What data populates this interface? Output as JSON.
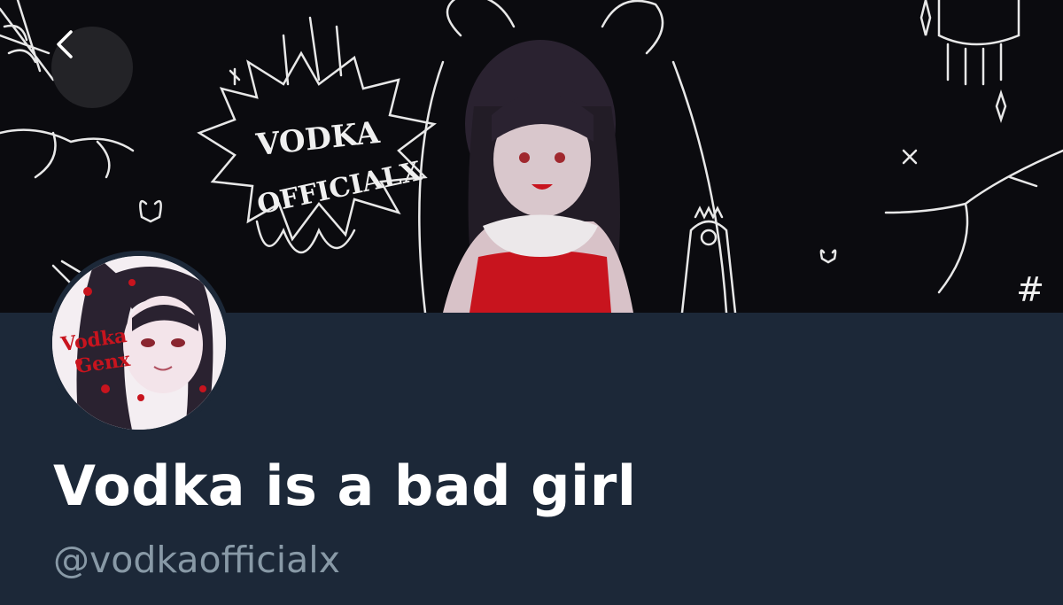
{
  "banner": {
    "art_text_line1": "VODKA",
    "art_text_line2": "OFFICIALX",
    "hash_glyph": "#"
  },
  "nav": {
    "back_icon": "chevron-left-icon"
  },
  "avatar": {
    "logo_line1": "Vodka",
    "logo_line2": "Genx"
  },
  "profile": {
    "display_name": "Vodka is a bad girl",
    "handle": "@vodkaofficialx"
  },
  "colors": {
    "profile_bg": "#1c2838",
    "banner_bg": "#0b0b0f",
    "name_color": "#ffffff",
    "handle_color": "#8899a6",
    "accent_red": "#c8141e"
  }
}
